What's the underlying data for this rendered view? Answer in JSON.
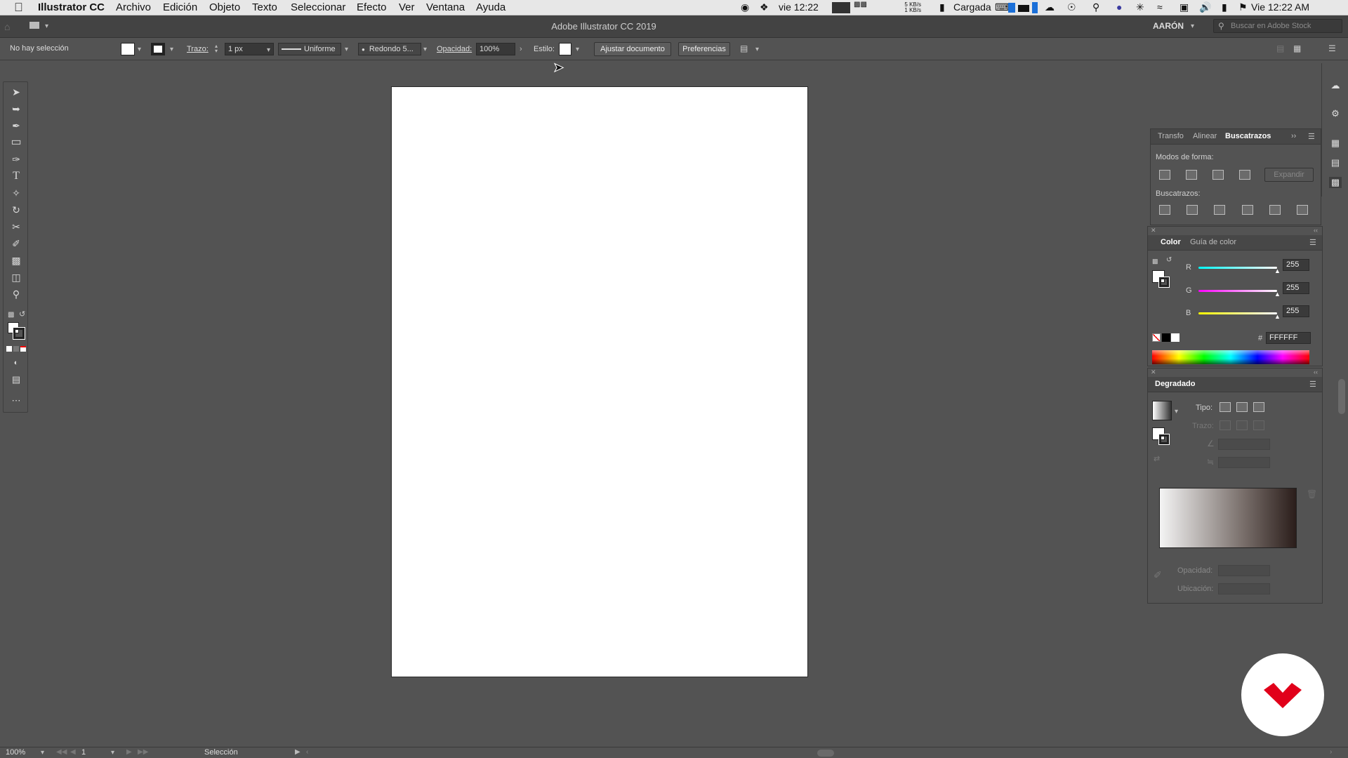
{
  "menubar": {
    "app_name": "Illustrator CC",
    "menus": [
      "Archivo",
      "Edición",
      "Objeto",
      "Texto",
      "Seleccionar",
      "Efecto",
      "Ver",
      "Ventana",
      "Ayuda"
    ],
    "status": {
      "short_time": "vie 12:22",
      "net_up": "5 KB/s",
      "net_down": "1 KB/s",
      "battery": "Cargada",
      "clock": "Vie 12:22 AM"
    }
  },
  "appbar": {
    "title": "Adobe Illustrator CC 2019",
    "user": "AARÓN",
    "search_placeholder": "Buscar en Adobe Stock"
  },
  "control": {
    "selection": "No hay selección",
    "stroke_label": "Trazo:",
    "stroke_value": "1 px",
    "profile": "Uniforme",
    "brush": "Redondo 5...",
    "opacity_label": "Opacidad:",
    "opacity_value": "100%",
    "style_label": "Estilo:",
    "doc_button": "Ajustar documento",
    "prefs_button": "Preferencias"
  },
  "pathfinder": {
    "tabs": [
      "Transfo",
      "Alinear",
      "Buscatrazos"
    ],
    "shape_modes_label": "Modos de forma:",
    "expand_label": "Expandir",
    "pathfinders_label": "Buscatrazos:"
  },
  "color": {
    "tabs": [
      "Color",
      "Guía de color"
    ],
    "channels": [
      {
        "name": "R",
        "value": "255"
      },
      {
        "name": "G",
        "value": "255"
      },
      {
        "name": "B",
        "value": "255"
      }
    ],
    "hex_label": "#",
    "hex": "FFFFFF"
  },
  "gradient": {
    "title": "Degradado",
    "type_label": "Tipo:",
    "stroke_label": "Trazo:",
    "opacity_label": "Opacidad:",
    "location_label": "Ubicación:"
  },
  "status": {
    "zoom": "100%",
    "artboard": "1",
    "tool": "Selección"
  },
  "colors": {
    "workspace": "#535353",
    "brand": "#e1001a"
  }
}
